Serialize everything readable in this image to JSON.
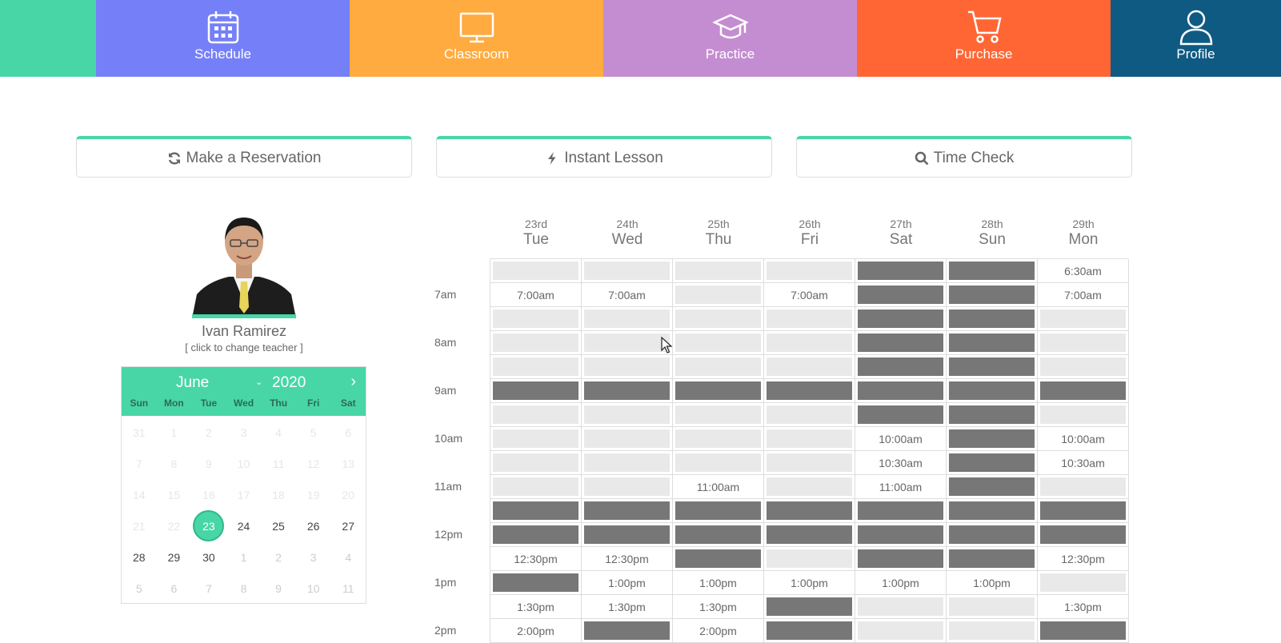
{
  "colors": {
    "home": "#48d6a6",
    "schedule": "#7580f8",
    "classroom": "#ffab40",
    "practice": "#c58dd1",
    "purchase": "#ff6634",
    "profile": "#0f5a83",
    "accent": "#48d6a6"
  },
  "nav": {
    "schedule": "Schedule",
    "classroom": "Classroom",
    "practice": "Practice",
    "purchase": "Purchase",
    "profile": "Profile"
  },
  "actions": {
    "reservation": "Make a Reservation",
    "instant": "Instant Lesson",
    "timecheck": "Time Check"
  },
  "teacher": {
    "name": "Ivan Ramirez",
    "change": "[ click to change teacher ]"
  },
  "calendar": {
    "month": "June",
    "year": "2020",
    "next_icon": "chevron-right-icon",
    "dows": [
      "Sun",
      "Mon",
      "Tue",
      "Wed",
      "Thu",
      "Fri",
      "Sat"
    ],
    "days": [
      {
        "d": "31",
        "s": "faint"
      },
      {
        "d": "1",
        "s": "faint"
      },
      {
        "d": "2",
        "s": "faint"
      },
      {
        "d": "3",
        "s": "faint"
      },
      {
        "d": "4",
        "s": "faint"
      },
      {
        "d": "5",
        "s": "faint"
      },
      {
        "d": "6",
        "s": "faint"
      },
      {
        "d": "7",
        "s": "faint"
      },
      {
        "d": "8",
        "s": "faint"
      },
      {
        "d": "9",
        "s": "faint"
      },
      {
        "d": "10",
        "s": "faint"
      },
      {
        "d": "11",
        "s": "faint"
      },
      {
        "d": "12",
        "s": "faint"
      },
      {
        "d": "13",
        "s": "faint"
      },
      {
        "d": "14",
        "s": "faint"
      },
      {
        "d": "15",
        "s": "faint"
      },
      {
        "d": "16",
        "s": "faint"
      },
      {
        "d": "17",
        "s": "faint"
      },
      {
        "d": "18",
        "s": "faint"
      },
      {
        "d": "19",
        "s": "faint"
      },
      {
        "d": "20",
        "s": "faint"
      },
      {
        "d": "21",
        "s": "faint"
      },
      {
        "d": "22",
        "s": "faint"
      },
      {
        "d": "23",
        "s": "sel"
      },
      {
        "d": "24",
        "s": ""
      },
      {
        "d": "25",
        "s": ""
      },
      {
        "d": "26",
        "s": ""
      },
      {
        "d": "27",
        "s": ""
      },
      {
        "d": "28",
        "s": ""
      },
      {
        "d": "29",
        "s": ""
      },
      {
        "d": "30",
        "s": ""
      },
      {
        "d": "1",
        "s": "other"
      },
      {
        "d": "2",
        "s": "other"
      },
      {
        "d": "3",
        "s": "other"
      },
      {
        "d": "4",
        "s": "other"
      },
      {
        "d": "5",
        "s": "other"
      },
      {
        "d": "6",
        "s": "other"
      },
      {
        "d": "7",
        "s": "other"
      },
      {
        "d": "8",
        "s": "other"
      },
      {
        "d": "9",
        "s": "other"
      },
      {
        "d": "10",
        "s": "other"
      },
      {
        "d": "11",
        "s": "other"
      }
    ]
  },
  "schedule": {
    "days": [
      {
        "num": "23rd",
        "name": "Tue"
      },
      {
        "num": "24th",
        "name": "Wed"
      },
      {
        "num": "25th",
        "name": "Thu"
      },
      {
        "num": "26th",
        "name": "Fri"
      },
      {
        "num": "27th",
        "name": "Sat"
      },
      {
        "num": "28th",
        "name": "Sun"
      },
      {
        "num": "29th",
        "name": "Mon"
      }
    ],
    "time_labels": [
      {
        "label": "7am",
        "row": 1
      },
      {
        "label": "8am",
        "row": 3
      },
      {
        "label": "9am",
        "row": 5
      },
      {
        "label": "10am",
        "row": 7
      },
      {
        "label": "11am",
        "row": 9
      },
      {
        "label": "12pm",
        "row": 11
      },
      {
        "label": "1pm",
        "row": 13
      },
      {
        "label": "2pm",
        "row": 15
      }
    ],
    "rows": [
      [
        "E",
        "E",
        "E",
        "E",
        "B",
        "B",
        "6:30am"
      ],
      [
        "7:00am",
        "7:00am",
        "E",
        "7:00am",
        "B",
        "B",
        "7:00am"
      ],
      [
        "E",
        "E",
        "E",
        "E",
        "B",
        "B",
        "E"
      ],
      [
        "E",
        "E",
        "E",
        "E",
        "B",
        "B",
        "E"
      ],
      [
        "E",
        "E",
        "E",
        "E",
        "B",
        "B",
        "E"
      ],
      [
        "B",
        "B",
        "B",
        "B",
        "B",
        "B",
        "B"
      ],
      [
        "E",
        "E",
        "E",
        "E",
        "B",
        "B",
        "E"
      ],
      [
        "E",
        "E",
        "E",
        "E",
        "10:00am",
        "B",
        "10:00am"
      ],
      [
        "E",
        "E",
        "E",
        "E",
        "10:30am",
        "B",
        "10:30am"
      ],
      [
        "E",
        "E",
        "11:00am",
        "E",
        "11:00am",
        "B",
        "E"
      ],
      [
        "B",
        "B",
        "B",
        "B",
        "B",
        "B",
        "B"
      ],
      [
        "B",
        "B",
        "B",
        "B",
        "B",
        "B",
        "B"
      ],
      [
        "12:30pm",
        "12:30pm",
        "B",
        "E",
        "B",
        "B",
        "12:30pm"
      ],
      [
        "B",
        "1:00pm",
        "1:00pm",
        "1:00pm",
        "1:00pm",
        "1:00pm",
        "E"
      ],
      [
        "1:30pm",
        "1:30pm",
        "1:30pm",
        "B",
        "E",
        "E",
        "1:30pm"
      ],
      [
        "2:00pm",
        "B",
        "2:00pm",
        "B",
        "E",
        "E",
        "B"
      ]
    ]
  }
}
